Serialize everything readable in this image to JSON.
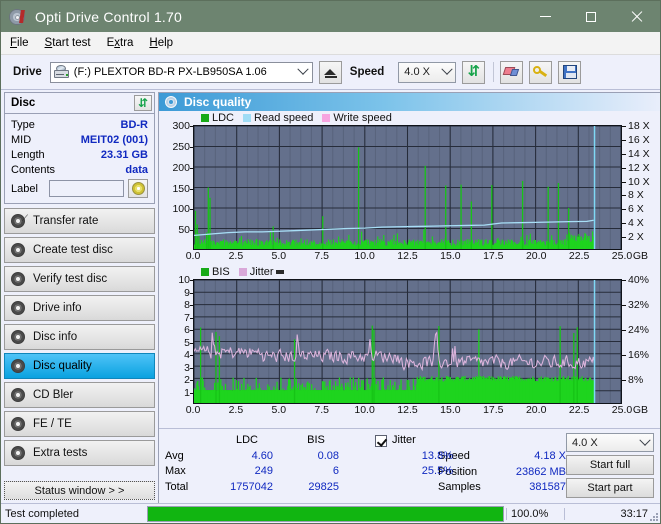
{
  "window": {
    "title": "Opti Drive Control 1.70",
    "icon": "disc-icon",
    "minimize": "–",
    "maximize": "▢",
    "close": "✕",
    "titlebar_color": "#6d8470"
  },
  "menu": {
    "items": [
      "File",
      "Start test",
      "Extra",
      "Help"
    ]
  },
  "toolbar": {
    "drive_label": "Drive",
    "drive_value": "(F:)   PLEXTOR BD-R  PX-LB950SA 1.06",
    "eject_tooltip": "Eject",
    "speed_label": "Speed",
    "speed_value": "4.0 X",
    "icons": [
      "drive-icon",
      "eject-icon",
      "refresh-icon",
      "eraser-icon",
      "keys-icon",
      "save-icon"
    ]
  },
  "sidebar": {
    "disc_panel": {
      "title": "Disc",
      "refresh_icon": "refresh-icon",
      "rows": [
        {
          "key": "Type",
          "value": "BD-R"
        },
        {
          "key": "MID",
          "value": "MEIT02 (001)"
        },
        {
          "key": "Length",
          "value": "23.31 GB"
        },
        {
          "key": "Contents",
          "value": "data"
        }
      ],
      "label_key": "Label",
      "label_value": "",
      "label_placeholder": ""
    },
    "nav": [
      {
        "label": "Transfer rate",
        "active": false
      },
      {
        "label": "Create test disc",
        "active": false
      },
      {
        "label": "Verify test disc",
        "active": false
      },
      {
        "label": "Drive info",
        "active": false
      },
      {
        "label": "Disc info",
        "active": false
      },
      {
        "label": "Disc quality",
        "active": true
      },
      {
        "label": "CD Bler",
        "active": false
      },
      {
        "label": "FE / TE",
        "active": false
      },
      {
        "label": "Extra tests",
        "active": false
      }
    ],
    "status_window_button": "Status window > >"
  },
  "main": {
    "header_title": "Disc quality",
    "header_icon": "disc-quality-icon"
  },
  "stats": {
    "columns": [
      "LDC",
      "BIS"
    ],
    "jitter_label": "Jitter",
    "jitter_checked": true,
    "rows": [
      {
        "key": "Avg",
        "ldc": "4.60",
        "bis": "0.08",
        "jitter": "13.8%"
      },
      {
        "key": "Max",
        "ldc": "249",
        "bis": "6",
        "jitter": "25.5%"
      },
      {
        "key": "Total",
        "ldc": "1757042",
        "bis": "29825",
        "jitter": ""
      }
    ],
    "info": [
      {
        "key": "Speed",
        "value": "4.18 X"
      },
      {
        "key": "Position",
        "value": "23862 MB"
      },
      {
        "key": "Samples",
        "value": "381587"
      }
    ],
    "speed_select": "4.0 X",
    "start_full": "Start full",
    "start_part": "Start part"
  },
  "statusbar": {
    "message": "Test completed",
    "progress_percent": "100.0%",
    "progress_value": 100,
    "elapsed": "33:17"
  },
  "chart_data": [
    {
      "type": "line",
      "name": "ldc-chart",
      "title": "",
      "xlabel": "GB",
      "ylabel": "",
      "xlim": [
        0,
        25
      ],
      "xticks": [
        "0.0",
        "2.5",
        "5.0",
        "7.5",
        "10.0",
        "12.5",
        "15.0",
        "17.5",
        "20.0",
        "22.5",
        "25.0"
      ],
      "xunit": "GB",
      "ylim": [
        0,
        300
      ],
      "yticks": [
        50,
        100,
        150,
        200,
        250,
        300
      ],
      "y2lim": [
        0,
        18
      ],
      "y2ticks": [
        "2 X",
        "4 X",
        "6 X",
        "8 X",
        "10 X",
        "12 X",
        "14 X",
        "16 X",
        "18 X"
      ],
      "grid": true,
      "legend": [
        {
          "label": "LDC",
          "color": "#18aa18"
        },
        {
          "label": "Read speed",
          "color": "#9fdcf5"
        },
        {
          "label": "Write speed",
          "color": "#f7a5e0"
        }
      ],
      "series": [
        {
          "name": "LDC",
          "kind": "bars",
          "color": "#18d018",
          "baseline_avg": 14,
          "x": [
            0.05,
            0.15,
            0.25,
            0.3,
            0.4,
            0.5,
            0.6,
            0.7,
            0.8,
            0.9,
            1.0,
            1.1,
            1.2,
            1.3,
            1.4,
            1.5,
            1.6,
            1.7,
            1.8,
            2.0,
            2.2,
            2.4,
            2.6,
            2.8,
            3.0,
            3.2,
            3.4,
            3.6,
            3.8,
            4.0,
            4.2,
            4.4,
            4.6,
            4.8,
            5.0,
            5.2,
            5.4,
            5.6,
            5.8,
            6.0,
            6.3,
            6.6,
            6.9,
            7.2,
            7.5,
            7.8,
            8.1,
            8.4,
            8.7,
            9.0,
            9.3,
            9.6,
            9.9,
            10.2,
            10.5,
            10.8,
            11.1,
            11.4,
            11.7,
            12.0,
            12.3,
            12.6,
            12.9,
            13.2,
            13.5,
            13.8,
            14.1,
            14.4,
            14.7,
            15.0,
            15.3,
            15.6,
            15.9,
            16.2,
            16.5,
            16.8,
            17.1,
            17.4,
            17.7,
            18.0,
            18.3,
            18.6,
            18.9,
            19.2,
            19.5,
            19.8,
            20.1,
            20.4,
            20.7,
            21.0,
            21.3,
            21.6,
            21.9,
            22.2,
            22.5,
            22.8,
            23.1,
            23.4
          ],
          "y": [
            93,
            60,
            38,
            22,
            30,
            26,
            20,
            40,
            150,
            125,
            30,
            22,
            18,
            26,
            20,
            24,
            18,
            22,
            26,
            20,
            18,
            24,
            20,
            18,
            22,
            20,
            18,
            16,
            20,
            22,
            18,
            20,
            55,
            20,
            18,
            22,
            24,
            20,
            18,
            20,
            22,
            18,
            20,
            24,
            80,
            22,
            18,
            20,
            24,
            20,
            18,
            248,
            24,
            20,
            22,
            18,
            20,
            24,
            20,
            18,
            22,
            20,
            24,
            18,
            203,
            22,
            20,
            18,
            155,
            20,
            24,
            157,
            22,
            116,
            20,
            18,
            24,
            156,
            20,
            22,
            18,
            20,
            24,
            166,
            20,
            18,
            22,
            20,
            152,
            24,
            161,
            20,
            100,
            26,
            20,
            18,
            16,
            14
          ]
        },
        {
          "name": "Read speed",
          "kind": "line",
          "color": "#a8dff7",
          "x": [
            0.0,
            1.0,
            2.0,
            3.0,
            4.0,
            5.0,
            6.0,
            7.0,
            8.0,
            9.0,
            10.0,
            11.0,
            12.0,
            13.0,
            14.0,
            15.0,
            16.0,
            17.0,
            18.0,
            19.0,
            20.0,
            21.0,
            22.0,
            23.0,
            23.4
          ],
          "y": [
            2.0,
            2.2,
            2.4,
            2.5,
            2.5,
            2.6,
            2.7,
            2.8,
            2.9,
            3.0,
            3.05,
            3.2,
            3.25,
            3.3,
            3.35,
            3.4,
            3.45,
            3.5,
            3.8,
            3.85,
            3.9,
            3.95,
            4.0,
            4.05,
            4.2
          ]
        },
        {
          "name": "Write speed",
          "kind": "line",
          "color": "#f7a5e0",
          "x": [],
          "y": []
        }
      ],
      "cursor_x": 23.45
    },
    {
      "type": "line",
      "name": "bis-jitter-chart",
      "title": "",
      "xlabel": "GB",
      "ylabel": "",
      "xlim": [
        0,
        25
      ],
      "xticks": [
        "0.0",
        "2.5",
        "5.0",
        "7.5",
        "10.0",
        "12.5",
        "15.0",
        "17.5",
        "20.0",
        "22.5",
        "25.0"
      ],
      "xunit": "GB",
      "ylim": [
        0,
        10
      ],
      "yticks": [
        1,
        2,
        3,
        4,
        5,
        6,
        7,
        8,
        9,
        10
      ],
      "y2lim": [
        0,
        40
      ],
      "y2ticks": [
        "8%",
        "16%",
        "24%",
        "32%",
        "40%"
      ],
      "grid": true,
      "legend": [
        {
          "label": "BIS",
          "color": "#18aa18"
        },
        {
          "label": "Jitter",
          "color": "#d9a8d9"
        }
      ],
      "series": [
        {
          "name": "BIS",
          "kind": "bars",
          "color": "#18d018",
          "baseline_avg": 1.1,
          "note": "dense green fill ~1 rising to ~2 after 13 GB, occasional spikes to 5-6"
        },
        {
          "name": "Jitter",
          "kind": "line",
          "color": "#dcb4dc",
          "avg_band": [
            3.0,
            4.2
          ],
          "note": "noisy pink trace averaging ~4.0 early, settling to ~3.3 later; peaks to 6.4"
        }
      ],
      "cursor_x": 23.45
    }
  ]
}
